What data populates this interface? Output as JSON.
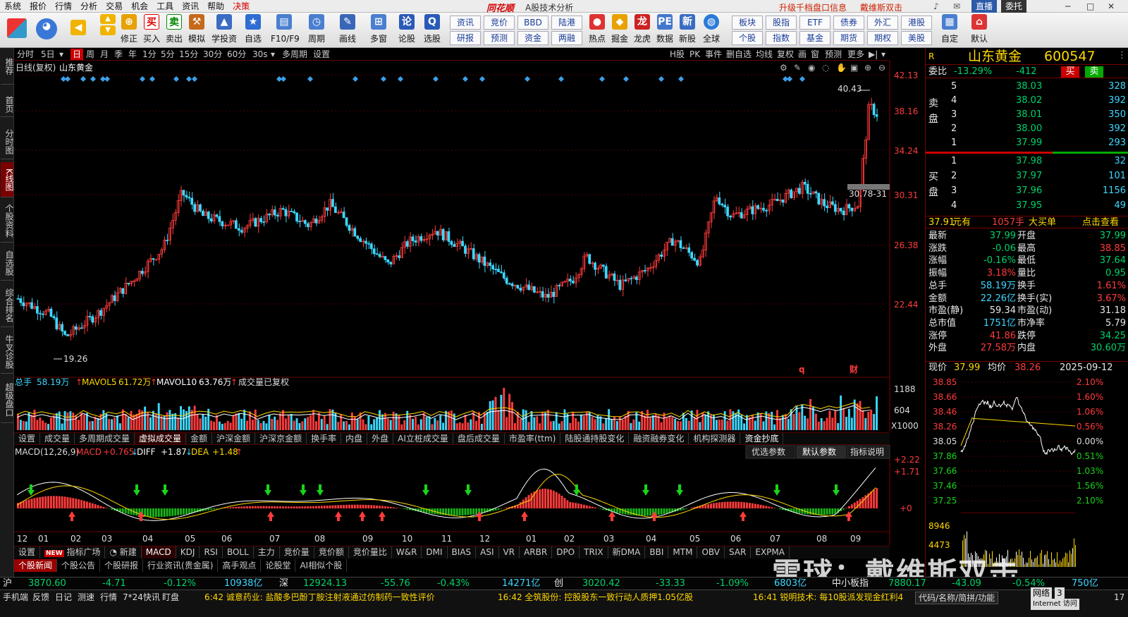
{
  "menu": {
    "items": [
      "系统",
      "报价",
      "行情",
      "分析",
      "交易",
      "机会",
      "工具",
      "资讯",
      "帮助",
      "决策"
    ],
    "logo": "同花顺",
    "subtitle": "A股技术分析",
    "promo1": "升级千档盘口信息",
    "promo2": "戴维斯双击",
    "btn_direct": "直播",
    "btn_order": "委托"
  },
  "toolbar": {
    "buttons": [
      "修正",
      "买入",
      "卖出",
      "模拟",
      "学投资",
      "自选",
      "F10/F9",
      "周期",
      "画线",
      "多窗",
      "论股",
      "选股"
    ],
    "grid": [
      [
        "资讯",
        "竞价",
        "BBD",
        "陆港"
      ],
      [
        "研报",
        "预测",
        "资金",
        "两融"
      ]
    ],
    "buttons2": [
      "热点",
      "掘金",
      "龙虎",
      "数据",
      "新股",
      "全球"
    ],
    "grid2": [
      [
        "板块",
        "股指",
        "ETF",
        "债券",
        "外汇",
        "港股"
      ],
      [
        "个股",
        "指数",
        "基金",
        "期货",
        "期权",
        "美股"
      ]
    ],
    "buttons3": [
      "自定",
      "默认"
    ]
  },
  "lefttabs": [
    "推荐",
    "首页",
    "分时图",
    "K线图",
    "个股资料",
    "自选股",
    "综合排名",
    "牛叉诊股",
    "超级盘口"
  ],
  "periods": [
    "分时",
    "5日",
    "日",
    "周",
    "月",
    "季",
    "年",
    "1分",
    "5分",
    "15分",
    "30分",
    "60分",
    "30s",
    "多周期",
    "设置"
  ],
  "period_active": "日",
  "topright_tools": [
    "H股",
    "PK",
    "事件",
    "删自选",
    "均线",
    "复权",
    "画",
    "窗",
    "预测",
    "更多"
  ],
  "kline": {
    "label": "日线(复权)",
    "stock": "山东黄金",
    "max_label": "40.43",
    "min_label": "19.26",
    "range_label": "30.78-31",
    "price_ticks": [
      "42.13",
      "38.16",
      "34.24",
      "30.31",
      "26.38",
      "22.44"
    ],
    "marker_q": "q",
    "marker_cai": "财"
  },
  "volume": {
    "label": "总手",
    "value": "58.19万",
    "mavol5_label": "MAVOL5",
    "mavol5": "61.72万",
    "mavol10_label": "MAVOL10",
    "mavol10": "63.76万",
    "note": "成交量已复权",
    "ticks": [
      "1188",
      "604",
      "X1000"
    ]
  },
  "tabs1": [
    "设置",
    "成交量",
    "多周期成交量",
    "虚拟成交量",
    "金额",
    "沪深金额",
    "沪深京金额",
    "换手率",
    "内盘",
    "外盘",
    "AI立桩成交量",
    "盘后成交量",
    "市盈率(ttm)",
    "陆股通持股变化",
    "融资融券变化",
    "机构探测器",
    "资金抄底"
  ],
  "tabs1_active": "虚拟成交量",
  "macd": {
    "label": "MACD(12,26,9)",
    "macd_label": "MACD",
    "macd": "+0.765",
    "diff_label": "DIFF",
    "diff": "+1.87",
    "dea_label": "DEA",
    "dea": "+1.48",
    "ticks": [
      "+2.22",
      "+1.71",
      "+0"
    ],
    "buttons": [
      "优选参数",
      "默认参数",
      "指标说明"
    ],
    "months": [
      "12",
      "01",
      "02",
      "03",
      "04",
      "05",
      "06",
      "07",
      "08",
      "09",
      "10",
      "11",
      "12",
      "01",
      "02",
      "03",
      "04",
      "05",
      "06",
      "07",
      "08",
      "09"
    ]
  },
  "tabs2": [
    "设置",
    "指标广场",
    "新建",
    "MACD",
    "KDJ",
    "RSI",
    "BOLL",
    "主力",
    "竞价量",
    "竞价额",
    "竞价量比",
    "W&R",
    "DMI",
    "BIAS",
    "ASI",
    "VR",
    "ARBR",
    "DPO",
    "TRIX",
    "新DMA",
    "BBI",
    "MTM",
    "OBV",
    "SAR",
    "EXPMA"
  ],
  "tabs2_active": "MACD",
  "new_badge": "NEW",
  "news_tabs": [
    "个股新闻",
    "个股公告",
    "个股研报",
    "行业资讯(贵金属)",
    "高手观点",
    "论股堂",
    "AI相似个股"
  ],
  "quote": {
    "tag": "R",
    "name": "山东黄金",
    "code": "600547",
    "weibi_label": "委比",
    "weibi": "-13.29%",
    "weicha": "-412",
    "buy_btn": "买",
    "sell_btn": "卖",
    "sell_side_label": "卖盘",
    "buy_side_label": "买盘",
    "asks": [
      {
        "lvl": "5",
        "price": "38.03",
        "vol": "328"
      },
      {
        "lvl": "4",
        "price": "38.02",
        "vol": "392"
      },
      {
        "lvl": "3",
        "price": "38.01",
        "vol": "350"
      },
      {
        "lvl": "2",
        "price": "38.00",
        "vol": "392"
      },
      {
        "lvl": "1",
        "price": "37.99",
        "vol": "293"
      }
    ],
    "bids": [
      {
        "lvl": "1",
        "price": "37.98",
        "vol": "32"
      },
      {
        "lvl": "2",
        "price": "37.97",
        "vol": "101"
      },
      {
        "lvl": "3",
        "price": "37.96",
        "vol": "1156"
      },
      {
        "lvl": "4",
        "price": "37.95",
        "vol": "49"
      }
    ],
    "bigorder": {
      "price": "37.91",
      "unit": "元有",
      "qty": "1057手",
      "what": "大买单",
      "action": "点击查看"
    },
    "stats": [
      [
        "最新",
        "37.99",
        "开盘",
        "37.99"
      ],
      [
        "涨跌",
        "-0.06",
        "最高",
        "38.85"
      ],
      [
        "涨幅",
        "-0.16%",
        "最低",
        "37.64"
      ],
      [
        "振幅",
        "3.18%",
        "量比",
        "0.95"
      ],
      [
        "总手",
        "58.19万",
        "换手",
        "1.61%"
      ],
      [
        "金额",
        "22.26亿",
        "换手(实)",
        "3.67%"
      ],
      [
        "市盈(静)",
        "59.34",
        "市盈(动)",
        "31.18"
      ],
      [
        "总市值",
        "1751亿",
        "市净率",
        "5.79"
      ],
      [
        "涨停",
        "41.86",
        "跌停",
        "34.25"
      ],
      [
        "外盘",
        "27.58万",
        "内盘",
        "30.60万"
      ]
    ],
    "intraday": {
      "price_label": "现价",
      "price": "37.99",
      "avg_label": "均价",
      "avg": "38.26",
      "date": "2025-09-12",
      "left_ticks": [
        "38.85",
        "38.66",
        "38.46",
        "38.26",
        "38.05",
        "37.86",
        "37.66",
        "37.46",
        "37.25"
      ],
      "right_ticks": [
        "2.10%",
        "1.60%",
        "1.06%",
        "0.56%",
        "0.00%",
        "0.51%",
        "1.03%",
        "1.56%",
        "2.10%"
      ],
      "vol_ticks": [
        "8946",
        "4473"
      ]
    }
  },
  "indexbar": [
    {
      "name": "沪",
      "val": "3870.60",
      "chg": "-4.71",
      "pct": "-0.12%",
      "amt": "10938亿"
    },
    {
      "name": "深",
      "val": "12924.13",
      "chg": "-55.76",
      "pct": "-0.43%",
      "amt": "14271亿"
    },
    {
      "name": "创",
      "val": "3020.42",
      "chg": "-33.33",
      "pct": "-1.09%",
      "amt": "6803亿"
    }
  ],
  "indexbar_extra": {
    "name": "中小板指",
    "val": "7880.17",
    "chg": "-43.09",
    "pct": "-0.54%",
    "amt": "750亿"
  },
  "status": {
    "left": [
      "手机端",
      "反馈",
      "日记",
      "测速",
      "行情",
      "7*24快讯",
      "盯盘"
    ],
    "news1": "6:42 诚意药业: 盐酸多巴酚丁胺注射液通过仿制药一致性评价",
    "news2": "16:42 全筑股份: 控股股东一致行动人质押1.05亿股",
    "news3": "16:41 锐明技术: 每10股派发现金红利4",
    "right": [
      "代码/名称/简拼/功能",
      "网络",
      "3",
      "Internet 访问",
      "17"
    ]
  },
  "watermark": "雪球：戴维斯双击"
}
